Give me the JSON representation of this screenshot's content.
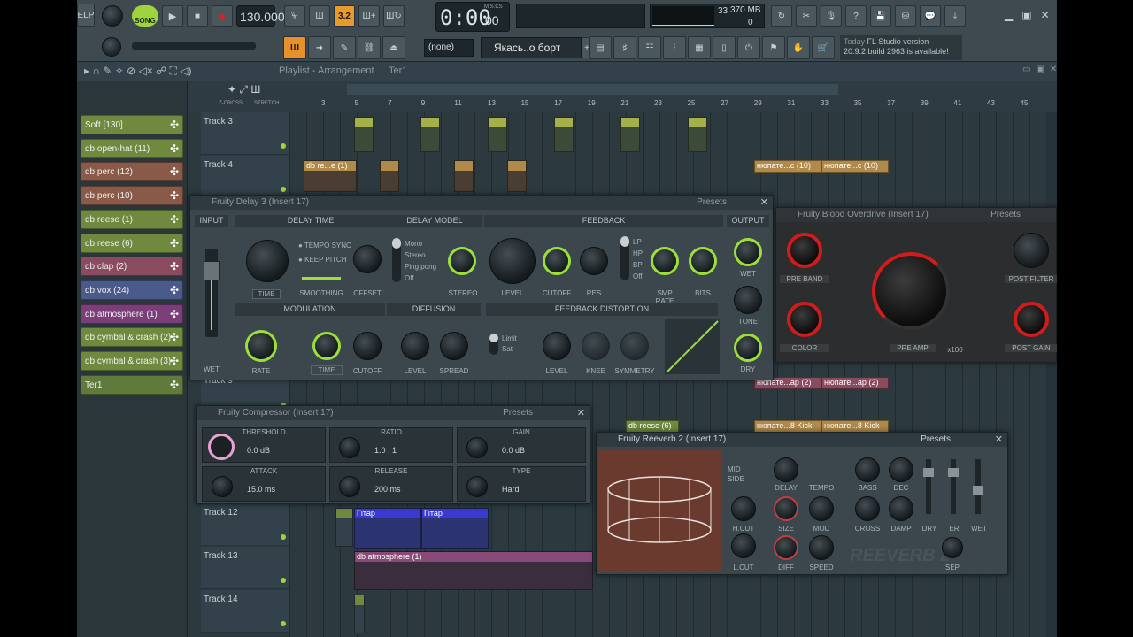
{
  "toolbar": {
    "menu_help": "ELP",
    "song_label": "SONG",
    "tempo": "130.000",
    "time": "0:00",
    "time_sub": "00",
    "time_unit": "M:S:CS",
    "cpu": "33",
    "memory": "370 MB",
    "poly": "0",
    "pattern_none": "(none)",
    "pattern_name": "Якась..о борт",
    "news_day": "Today",
    "news_line1": "FL Studio version",
    "news_line2": "20.9.2 build 2963 is available!"
  },
  "playlist": {
    "title": "Playlist - Arrangement",
    "crumb": "Ter1",
    "zcross": "Z-CROSS",
    "stretch": "STRETCH",
    "ruler": [
      "3",
      "5",
      "7",
      "9",
      "11",
      "13",
      "15",
      "17",
      "19",
      "21",
      "23",
      "25",
      "27",
      "29",
      "31",
      "33",
      "35",
      "37",
      "39",
      "41",
      "43",
      "45"
    ]
  },
  "patterns": [
    {
      "label": "Soft [130]",
      "color": "#6f8a3e"
    },
    {
      "label": "db open-hat (11)",
      "color": "#6f8a3e"
    },
    {
      "label": "db perc (12)",
      "color": "#8a5a48"
    },
    {
      "label": "db perc (10)",
      "color": "#8a5a48"
    },
    {
      "label": "db reese (1)",
      "color": "#6f8a3e"
    },
    {
      "label": "db reese (6)",
      "color": "#6f8a3e"
    },
    {
      "label": "db clap (2)",
      "color": "#8a4a60"
    },
    {
      "label": "db vox (24)",
      "color": "#4a5a8a"
    },
    {
      "label": "db atmosphere (1)",
      "color": "#7a3f78"
    },
    {
      "label": "db cymbal & crash (2)",
      "color": "#6f8a3e"
    },
    {
      "label": "db cymbal & crash (3)",
      "color": "#6f8a3e"
    },
    {
      "label": "Ter1",
      "color": "#5f7a3a"
    }
  ],
  "tracks": [
    {
      "label": "Track 3"
    },
    {
      "label": "Track 4"
    },
    {
      "label": "Track 9"
    },
    {
      "label": "Track 12"
    },
    {
      "label": "Track 13"
    },
    {
      "label": "Track 14"
    }
  ],
  "clips": {
    "reese": "db re...e (1)",
    "nyupate1": "нюпате...с (10)",
    "nyupate2": "нюпате...с (10)",
    "nyupate3": "нюпате...ар (2)",
    "nyupate4": "нюпате...ар (2)",
    "nyupate5": "нюпате...8 Kick",
    "nyupate6": "нюпате...8 Kick",
    "db_reese6": "db reese (6)",
    "gitar1": "Гітар",
    "gitar2": "Гітар",
    "atmos": "db atmosphere (1)"
  },
  "delay": {
    "title": "Fruity Delay 3 (Insert 17)",
    "presets": "Presets",
    "input": "INPUT",
    "delay_time": "DELAY TIME",
    "delay_model": "DELAY MODEL",
    "feedback": "FEEDBACK",
    "output": "OUTPUT",
    "tempo_sync": "TEMPO SYNC",
    "keep_pitch": "KEEP PITCH",
    "time": "TIME",
    "smoothing": "SMOOTHING",
    "offset": "OFFSET",
    "models": [
      "Mono",
      "Stereo",
      "Ping pong",
      "Off"
    ],
    "stereo": "STEREO",
    "level": "LEVEL",
    "cutoff": "CUTOFF",
    "res": "RES",
    "filters": [
      "LP",
      "HP",
      "BP",
      "Off"
    ],
    "smp_rate": "SMP RATE",
    "bits": "BITS",
    "wet": "WET",
    "tone": "TONE",
    "dry": "DRY",
    "modulation": "MODULATION",
    "diffusion": "DIFFUSION",
    "fb_dist": "FEEDBACK DISTORTION",
    "rate": "RATE",
    "mod_time": "TIME",
    "mod_cutoff": "CUTOFF",
    "diff_level": "LEVEL",
    "spread": "SPREAD",
    "limit": "Limit",
    "sat": "Sat",
    "dist_level": "LEVEL",
    "knee": "KNEE",
    "symmetry": "SYMMETRY",
    "wet_side": "WET"
  },
  "overdrive": {
    "title": "Fruity Blood Overdrive (Insert 17)",
    "presets": "Presets",
    "preband": "PRE BAND",
    "color": "COLOR",
    "preamp": "PRE AMP",
    "x100": "x100",
    "postfilter": "POST FILTER",
    "postgain": "POST GAIN"
  },
  "compressor": {
    "title": "Fruity Compressor (Insert 17)",
    "presets": "Presets",
    "threshold": "THRESHOLD",
    "threshold_v": "0.0 dB",
    "ratio": "RATIO",
    "ratio_v": "1.0 : 1",
    "gain": "GAIN",
    "gain_v": "0.0 dB",
    "attack": "ATTACK",
    "attack_v": "15.0 ms",
    "release": "RELEASE",
    "release_v": "200 ms",
    "type": "TYPE",
    "type_v": "Hard"
  },
  "reverb": {
    "title": "Fruity Reeverb 2 (Insert 17)",
    "presets": "Presets",
    "mid": "MID",
    "side": "SIDE",
    "hcut": "H.CUT",
    "lcut": "L.CUT",
    "delay": "DELAY",
    "tempo": "TEMPO",
    "size": "SIZE",
    "mod": "MOD",
    "diff": "DIFF",
    "speed": "SPEED",
    "bass": "BASS",
    "dec": "DEC",
    "cross": "CROSS",
    "damp": "DAMP",
    "dry": "DRY",
    "er": "ER",
    "wet": "WET",
    "sep": "SEP",
    "logo": "REEVERB 2"
  }
}
